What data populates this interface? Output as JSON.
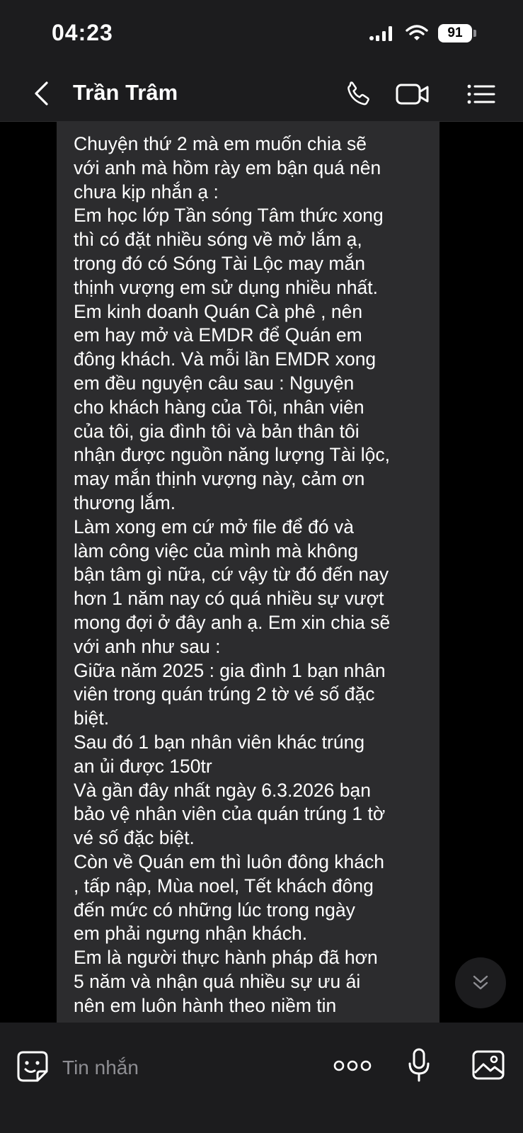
{
  "status_bar": {
    "time": "04:23",
    "battery": "91"
  },
  "header": {
    "contact_name": "Trần Trâm"
  },
  "message": {
    "lines": [
      "Chuyện thứ 2 mà em muốn chia sẽ",
      "với anh mà hồm rày em bận quá nên",
      "chưa kịp nhắn ạ :",
      "Em học lớp Tần sóng Tâm thức xong",
      "thì có đặt nhiều sóng về mở lắm ạ,",
      "trong đó có Sóng Tài Lộc may mắn",
      "thịnh vượng em sử dụng nhiều nhất.",
      "Em kinh doanh Quán Cà phê , nên",
      "em hay mở và EMDR để Quán em",
      "đông khách. Và mỗi lần EMDR xong",
      "em đều nguyện câu sau : Nguyện",
      "cho khách hàng của Tôi, nhân viên",
      "của tôi, gia đình tôi và bản thân tôi",
      "nhận được nguồn năng lượng Tài lộc,",
      "may mắn thịnh vượng này, cảm ơn",
      "thương lắm.",
      "Làm xong em cứ mở file để đó và",
      "làm công việc của mình mà không",
      "bận tâm gì nữa, cứ vậy từ đó đến nay",
      "hơn 1 năm nay có quá nhiều sự vượt",
      "mong đợi ở đây anh ạ. Em xin chia sẽ",
      "với anh như sau :",
      "Giữa năm 2025 : gia đình 1 bạn nhân",
      "viên trong quán trúng 2 tờ vé số đặc",
      "biệt.",
      "Sau đó 1 bạn nhân viên khác trúng",
      "an ủi được 150tr",
      "Và gần đây nhất ngày 6.3.2026 bạn",
      "bảo vệ nhân viên của quán trúng 1 tờ",
      "vé số đặc biệt.",
      "Còn về Quán em thì luôn đông khách",
      ", tấp nập, Mùa noel, Tết khách đông",
      "đến mức có những lúc trong ngày",
      "em phải ngưng nhận khách.",
      "Em là người thực hành pháp đã hơn",
      "5 năm và nhận quá nhiều sự ưu ái",
      "nên em luôn hành theo niềm tin"
    ]
  },
  "input": {
    "placeholder": "Tin nhắn"
  },
  "icons": {
    "back": "chevron-left-icon",
    "call": "phone-icon",
    "video": "video-camera-icon",
    "menu": "list-menu-icon",
    "scroll": "double-chevron-down-icon",
    "sticker": "sticker-face-icon",
    "more": "more-dots-icon",
    "mic": "microphone-icon",
    "image": "image-icon"
  },
  "colors": {
    "bar_bg": "#1c1c1e",
    "chat_bg": "#000000",
    "bubble_bg": "#2c2c2e",
    "placeholder": "#8e8e93"
  }
}
